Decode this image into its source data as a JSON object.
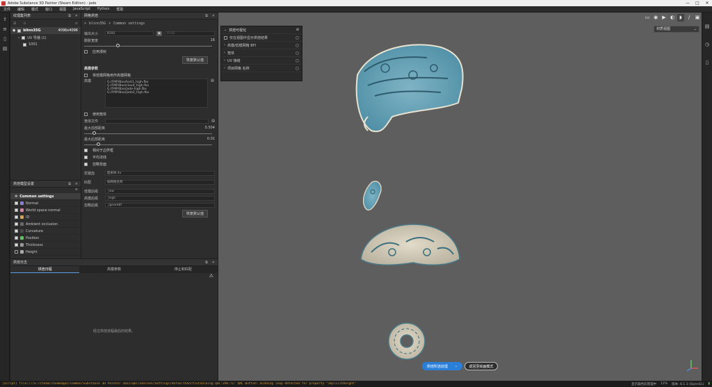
{
  "window": {
    "title": "Adobe Substance 3D Painter (Steam Edition) - jade",
    "controls": [
      "—",
      "□",
      "✕"
    ]
  },
  "menu": [
    "文件",
    "编辑",
    "模式",
    "窗口",
    "视图",
    "JavaScript",
    "Python",
    "帮助"
  ],
  "texture_set": {
    "panel_title": "纹理集列表",
    "items": [
      {
        "label": "blinn35G",
        "value": "4096x4096",
        "selected": true
      },
      {
        "label": "UV 导播 (1)"
      },
      {
        "label": "1001"
      }
    ]
  },
  "bake_settings": {
    "panel_title": "烘焙模型设置",
    "items": [
      {
        "label": "Common settings",
        "highlight": true,
        "color": "#cccccc"
      },
      {
        "label": "Normal",
        "checked": true,
        "color": "#8a7fd9"
      },
      {
        "label": "World space normal",
        "checked": true,
        "color": "#d97fa8"
      },
      {
        "label": "ID",
        "checked": true,
        "color": "#d9a24a"
      },
      {
        "label": "Ambient occlusion",
        "checked": true,
        "color": "#6a6a6a"
      },
      {
        "label": "Curvature",
        "checked": true,
        "color": "#4a4a4a"
      },
      {
        "label": "Position",
        "checked": true,
        "color": "#5ac85a"
      },
      {
        "label": "Thickness",
        "checked": true,
        "color": "#9a9a9a"
      },
      {
        "label": "Height",
        "checked": false,
        "color": "#aaaaaa"
      }
    ]
  },
  "bake_main": {
    "panel_title": "网格烘焙",
    "breadcrumb": [
      ">",
      "blinn35G",
      ">",
      "Common settings"
    ],
    "output_size_label": "输出大小",
    "output_size_value": "8192",
    "output_size_value2": "8192",
    "dilation_label": "膨胀宽度",
    "dilation_value": "16",
    "apply_diffusion": "应用漫射",
    "reset_button": "恢复默认值",
    "high_section": "高模参数",
    "use_low_as_high": "将低模网格用作高模网格",
    "mesh_label": "高模",
    "mesh_files": [
      "G:/FMP/Bao/test1_high.fbx",
      "G:/FMP/Bao/cloud_high.fbx",
      "G:/FMP/Bao/jade-high.fbx",
      "G:/FMP/Bao/jade2_high.fbx"
    ],
    "cage_label": "使用笼体",
    "cage_file_label": "笼体文件",
    "max_front_label": "最大前部距离",
    "max_front_value": "0.504",
    "max_rear_label": "最大后部距离",
    "max_rear_value": "0.01",
    "relative_bbox": "相对于边界框",
    "average_normals": "平均法线",
    "ignore_backface": "忽略背面",
    "antialias_label": "抗锯齿",
    "antialias_value": "超采样 4x",
    "match_label": "匹配",
    "match_value": "按网格名称",
    "low_suffix_label": "低模后缀",
    "low_suffix_value": "_low",
    "high_suffix_label": "高模后缀",
    "high_suffix_value": "_high",
    "ignore_suffix_label": "忽略后缀",
    "ignore_suffix_value": "_ignorebf",
    "reset_button2": "恢复默认值"
  },
  "log": {
    "panel_title": "烘焙日志",
    "tabs": [
      "烘焙日程",
      "高模参数",
      "停止和匹配"
    ],
    "empty_message": "经过烘焙流程最后的结果。"
  },
  "overlay": {
    "title": "烘焙可视化",
    "rows": [
      "仅在视图中显示烘焙结果",
      "高模/低模网格 BFI",
      "笼体",
      "UV 接缝",
      "项目网格 名称"
    ]
  },
  "viewport": {
    "view_select": "材质视图",
    "bake_button": "烘焙所选纹理",
    "return_button": "返回至绘画模式"
  },
  "status": {
    "error": "[Script] file:///G:/steam/steamapps/common/Substance 3D Painter 2022/qml/Shelves/Settings/DefaultShortcutsDialog.qml:296:71: QML Button: Binding loop detected for property \"implicitHeight\"",
    "right": [
      "显示器色彩管理中",
      "12%",
      "版本: 8.1.3 (OpenGL)"
    ]
  }
}
